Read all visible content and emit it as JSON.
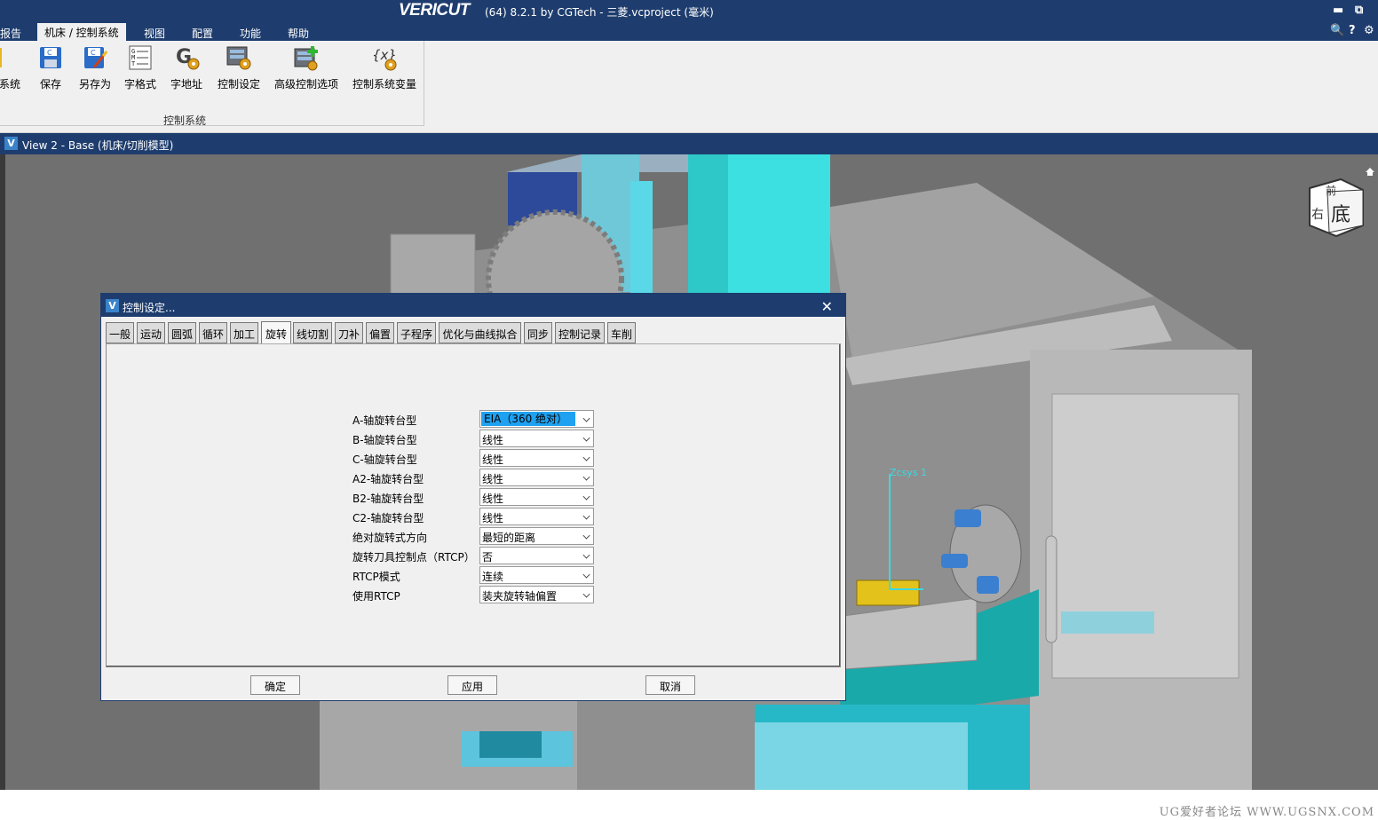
{
  "app": {
    "brand": "VERICUT",
    "title": "(64)  8.2.1 by CGTech - 三菱.vcproject (毫米)",
    "minimize_glyph": "▬",
    "restore_glyph": "⧉",
    "search_glyph": "🔍",
    "help_glyph": "?",
    "settings_glyph": "⚙"
  },
  "menu": {
    "items": [
      "报告",
      "机床 / 控制系统",
      "视图",
      "配置",
      "功能",
      "帮助"
    ],
    "active_index": 1
  },
  "ribbon": {
    "buttons": [
      "系统",
      "保存",
      "另存为",
      "字格式",
      "字地址",
      "控制设定",
      "高级控制选项",
      "控制系统变量"
    ],
    "group_label": "控制系统"
  },
  "view": {
    "logo": "V",
    "title": "View 2 - Base (机床/切削模型)",
    "cube_face": "底",
    "cube_side": "右",
    "cube_top": "前"
  },
  "dialog": {
    "logo": "V",
    "title": "控制设定...",
    "close_glyph": "✕",
    "tabs": [
      "一般",
      "运动",
      "圆弧",
      "循环",
      "加工",
      "旋转",
      "线切割",
      "刀补",
      "偏置",
      "子程序",
      "优化与曲线拟合",
      "同步",
      "控制记录",
      "车削"
    ],
    "selected_tab": 5,
    "rows": [
      {
        "label": "A-轴旋转台型",
        "value": "EIA（360 绝对）"
      },
      {
        "label": "B-轴旋转台型",
        "value": "线性"
      },
      {
        "label": "C-轴旋转台型",
        "value": "线性"
      },
      {
        "label": "A2-轴旋转台型",
        "value": "线性"
      },
      {
        "label": "B2-轴旋转台型",
        "value": "线性"
      },
      {
        "label": "C2-轴旋转台型",
        "value": "线性"
      },
      {
        "label": "绝对旋转式方向",
        "value": "最短的距离"
      },
      {
        "label": "旋转刀具控制点（RTCP）",
        "value": "否"
      },
      {
        "label": "RTCP模式",
        "value": "连续"
      },
      {
        "label": "使用RTCP",
        "value": "装夹旋转轴偏置"
      }
    ],
    "buttons": {
      "ok": "确定",
      "apply": "应用",
      "cancel": "取消"
    }
  },
  "footer": {
    "watermark": "UG爱好者论坛 WWW.UGSNX.COM"
  },
  "colors": {
    "titlebar": "#1e3d6e",
    "accent": "#1ea1f0",
    "cyan": "#35d6d6"
  }
}
